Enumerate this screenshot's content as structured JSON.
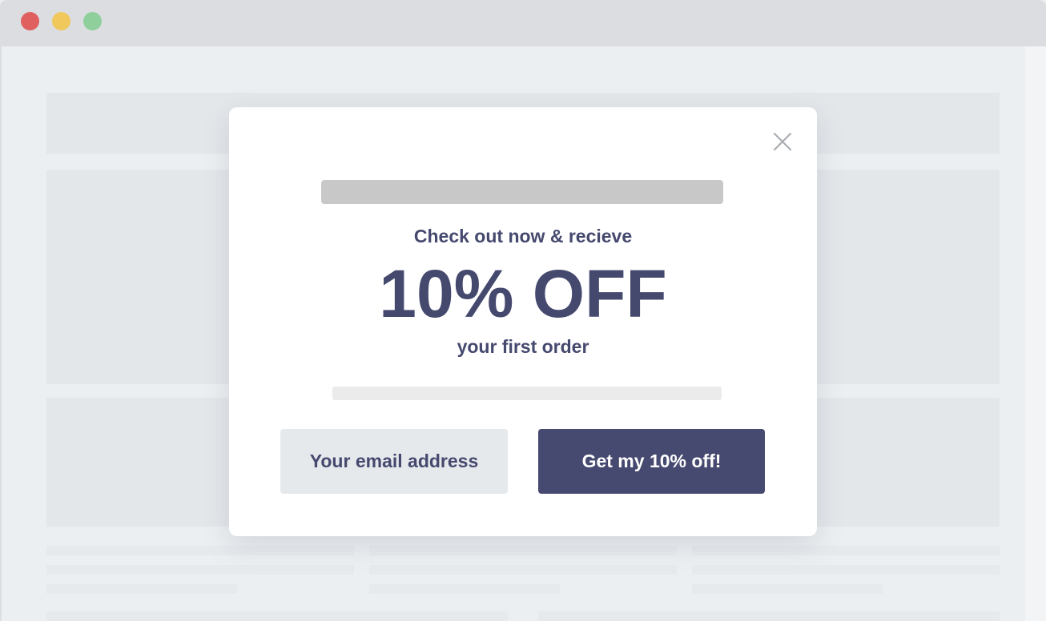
{
  "window": {
    "controls": {
      "close_color": "#e06060",
      "minimize_color": "#f0c85c",
      "maximize_color": "#8ecf9c"
    }
  },
  "popup": {
    "close_icon": "close-icon",
    "eyebrow": "Check out now & recieve",
    "headline": "10% OFF",
    "subline": "your first order",
    "email_placeholder": "Your email address",
    "cta_label": "Get my 10% off!"
  },
  "colors": {
    "text_primary": "#45496e",
    "button_bg": "#474a70",
    "button_text": "#ffffff",
    "input_bg": "#e6e9ec"
  }
}
